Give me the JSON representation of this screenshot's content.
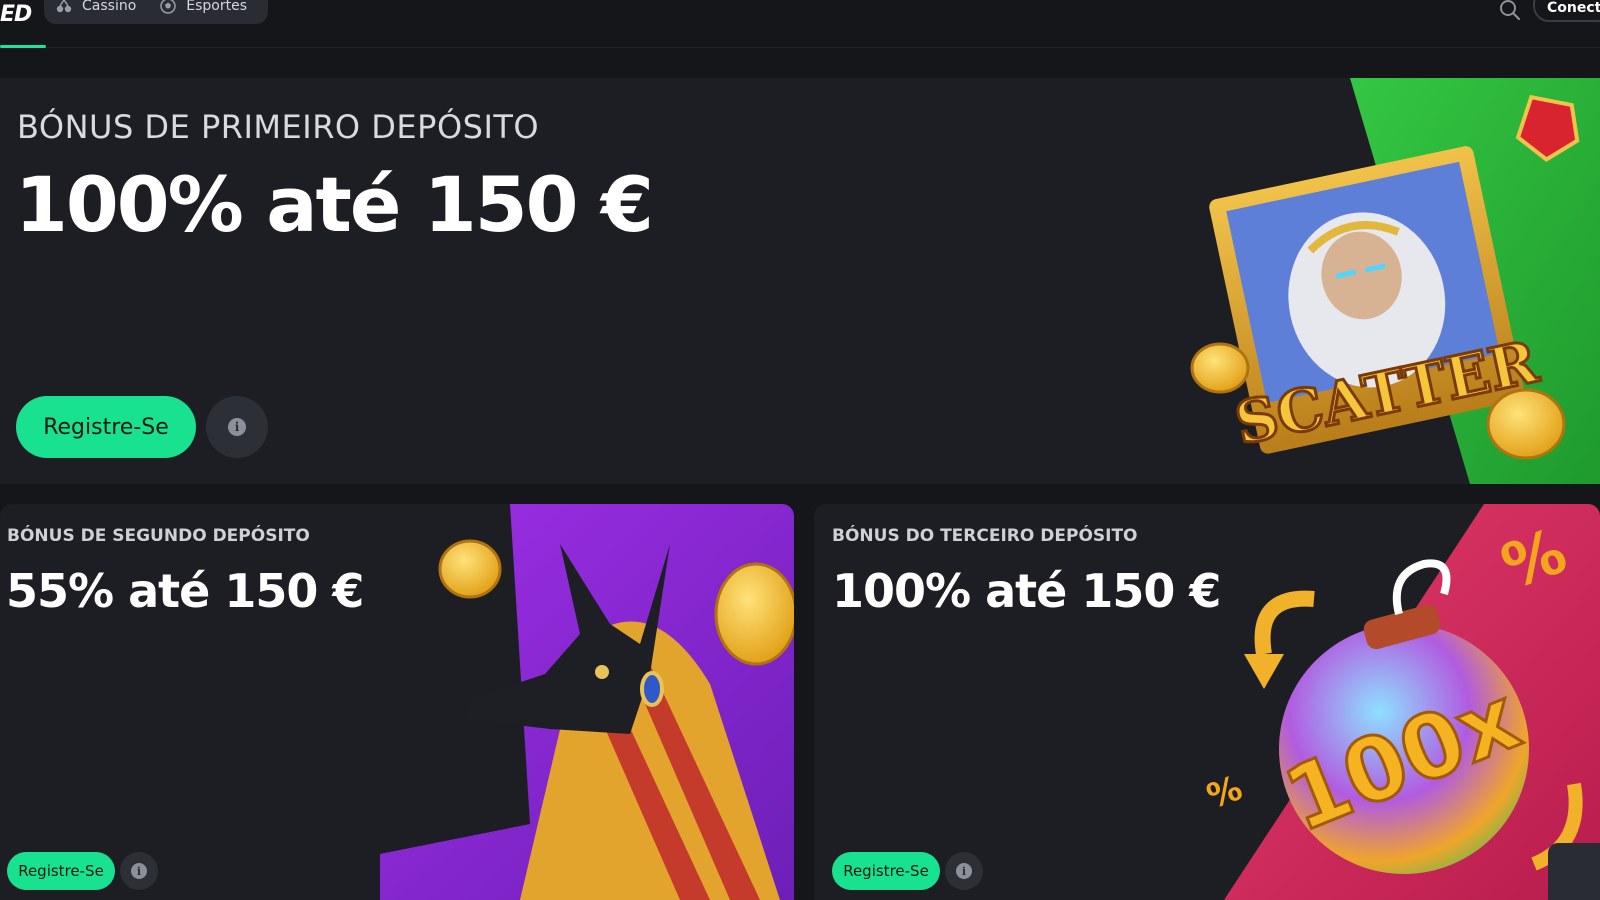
{
  "header": {
    "logo_text": "ED",
    "nav": [
      {
        "label": "Cassino",
        "icon": "cherries-icon"
      },
      {
        "label": "Esportes",
        "icon": "soccer-ball-icon"
      }
    ],
    "search_icon": "search-icon",
    "connect_label": "Conecte"
  },
  "hero": {
    "eyebrow": "BÓNUS DE PRIMEIRO DEPÓSITO",
    "title": "100% até 150 €",
    "register_label": "Registre-Se",
    "info_icon": "info-icon",
    "art_text": "SCATTER"
  },
  "cards": [
    {
      "eyebrow": "BÓNUS DE SEGUNDO DEPÓSITO",
      "title": "55% até 150 €",
      "register_label": "Registre-Se",
      "info_icon": "info-icon"
    },
    {
      "eyebrow": "BÓNUS DO TERCEIRO DEPÓSITO",
      "title": "100% até 150 €",
      "register_label": "Registre-Se",
      "info_icon": "info-icon",
      "art_text": "100x"
    }
  ],
  "colors": {
    "accent_green": "#18e18f",
    "background": "#15161a",
    "card": "#1d1e23",
    "hero_art_green": "#2dbb3a",
    "card2_art_purple": "#8a2bd6",
    "card3_art_magenta": "#d0295e"
  }
}
